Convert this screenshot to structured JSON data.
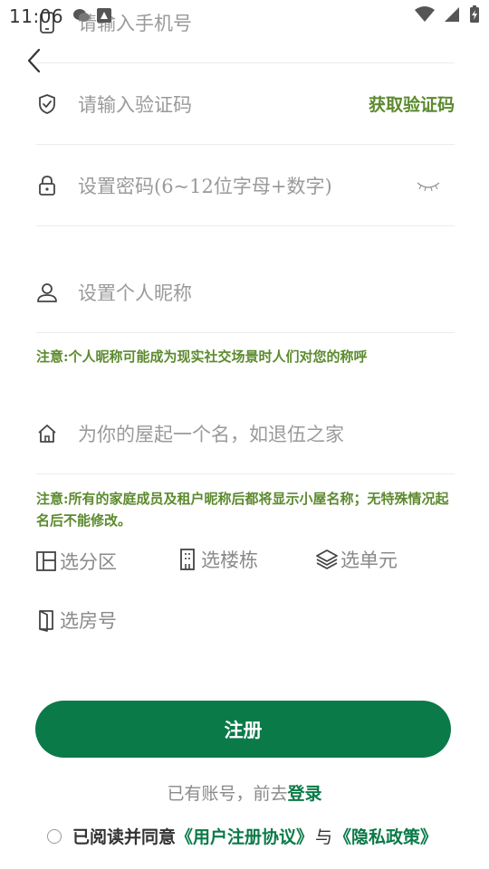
{
  "status_bar": {
    "time": "11:06"
  },
  "form": {
    "phone_placeholder": "请输入手机号",
    "code_placeholder": "请输入验证码",
    "get_code_label": "获取验证码",
    "password_placeholder": "设置密码(6~12位字母+数字)",
    "nickname_placeholder": "设置个人昵称",
    "nickname_note": "注意:个人昵称可能成为现实社交场景时人们对您的称呼",
    "house_placeholder": "为你的屋起一个名，如退伍之家",
    "house_note": "注意:所有的家庭成员及租户昵称后都将显示小屋名称；无特殊情况起名后不能修改。"
  },
  "selectors": {
    "district": "选分区",
    "building": "选楼栋",
    "unit": "选单元",
    "room": "选房号"
  },
  "register_label": "注册",
  "login": {
    "prefix": "已有账号，前去",
    "link": "登录"
  },
  "agreement": {
    "prefix": "已阅读并同意",
    "user_agreement": "《用户注册协议》",
    "and": "与",
    "privacy_policy": "《隐私政策》"
  },
  "colors": {
    "accent": "#0a7a48",
    "note": "#5c8a2e",
    "placeholder": "#9a9a9a"
  }
}
